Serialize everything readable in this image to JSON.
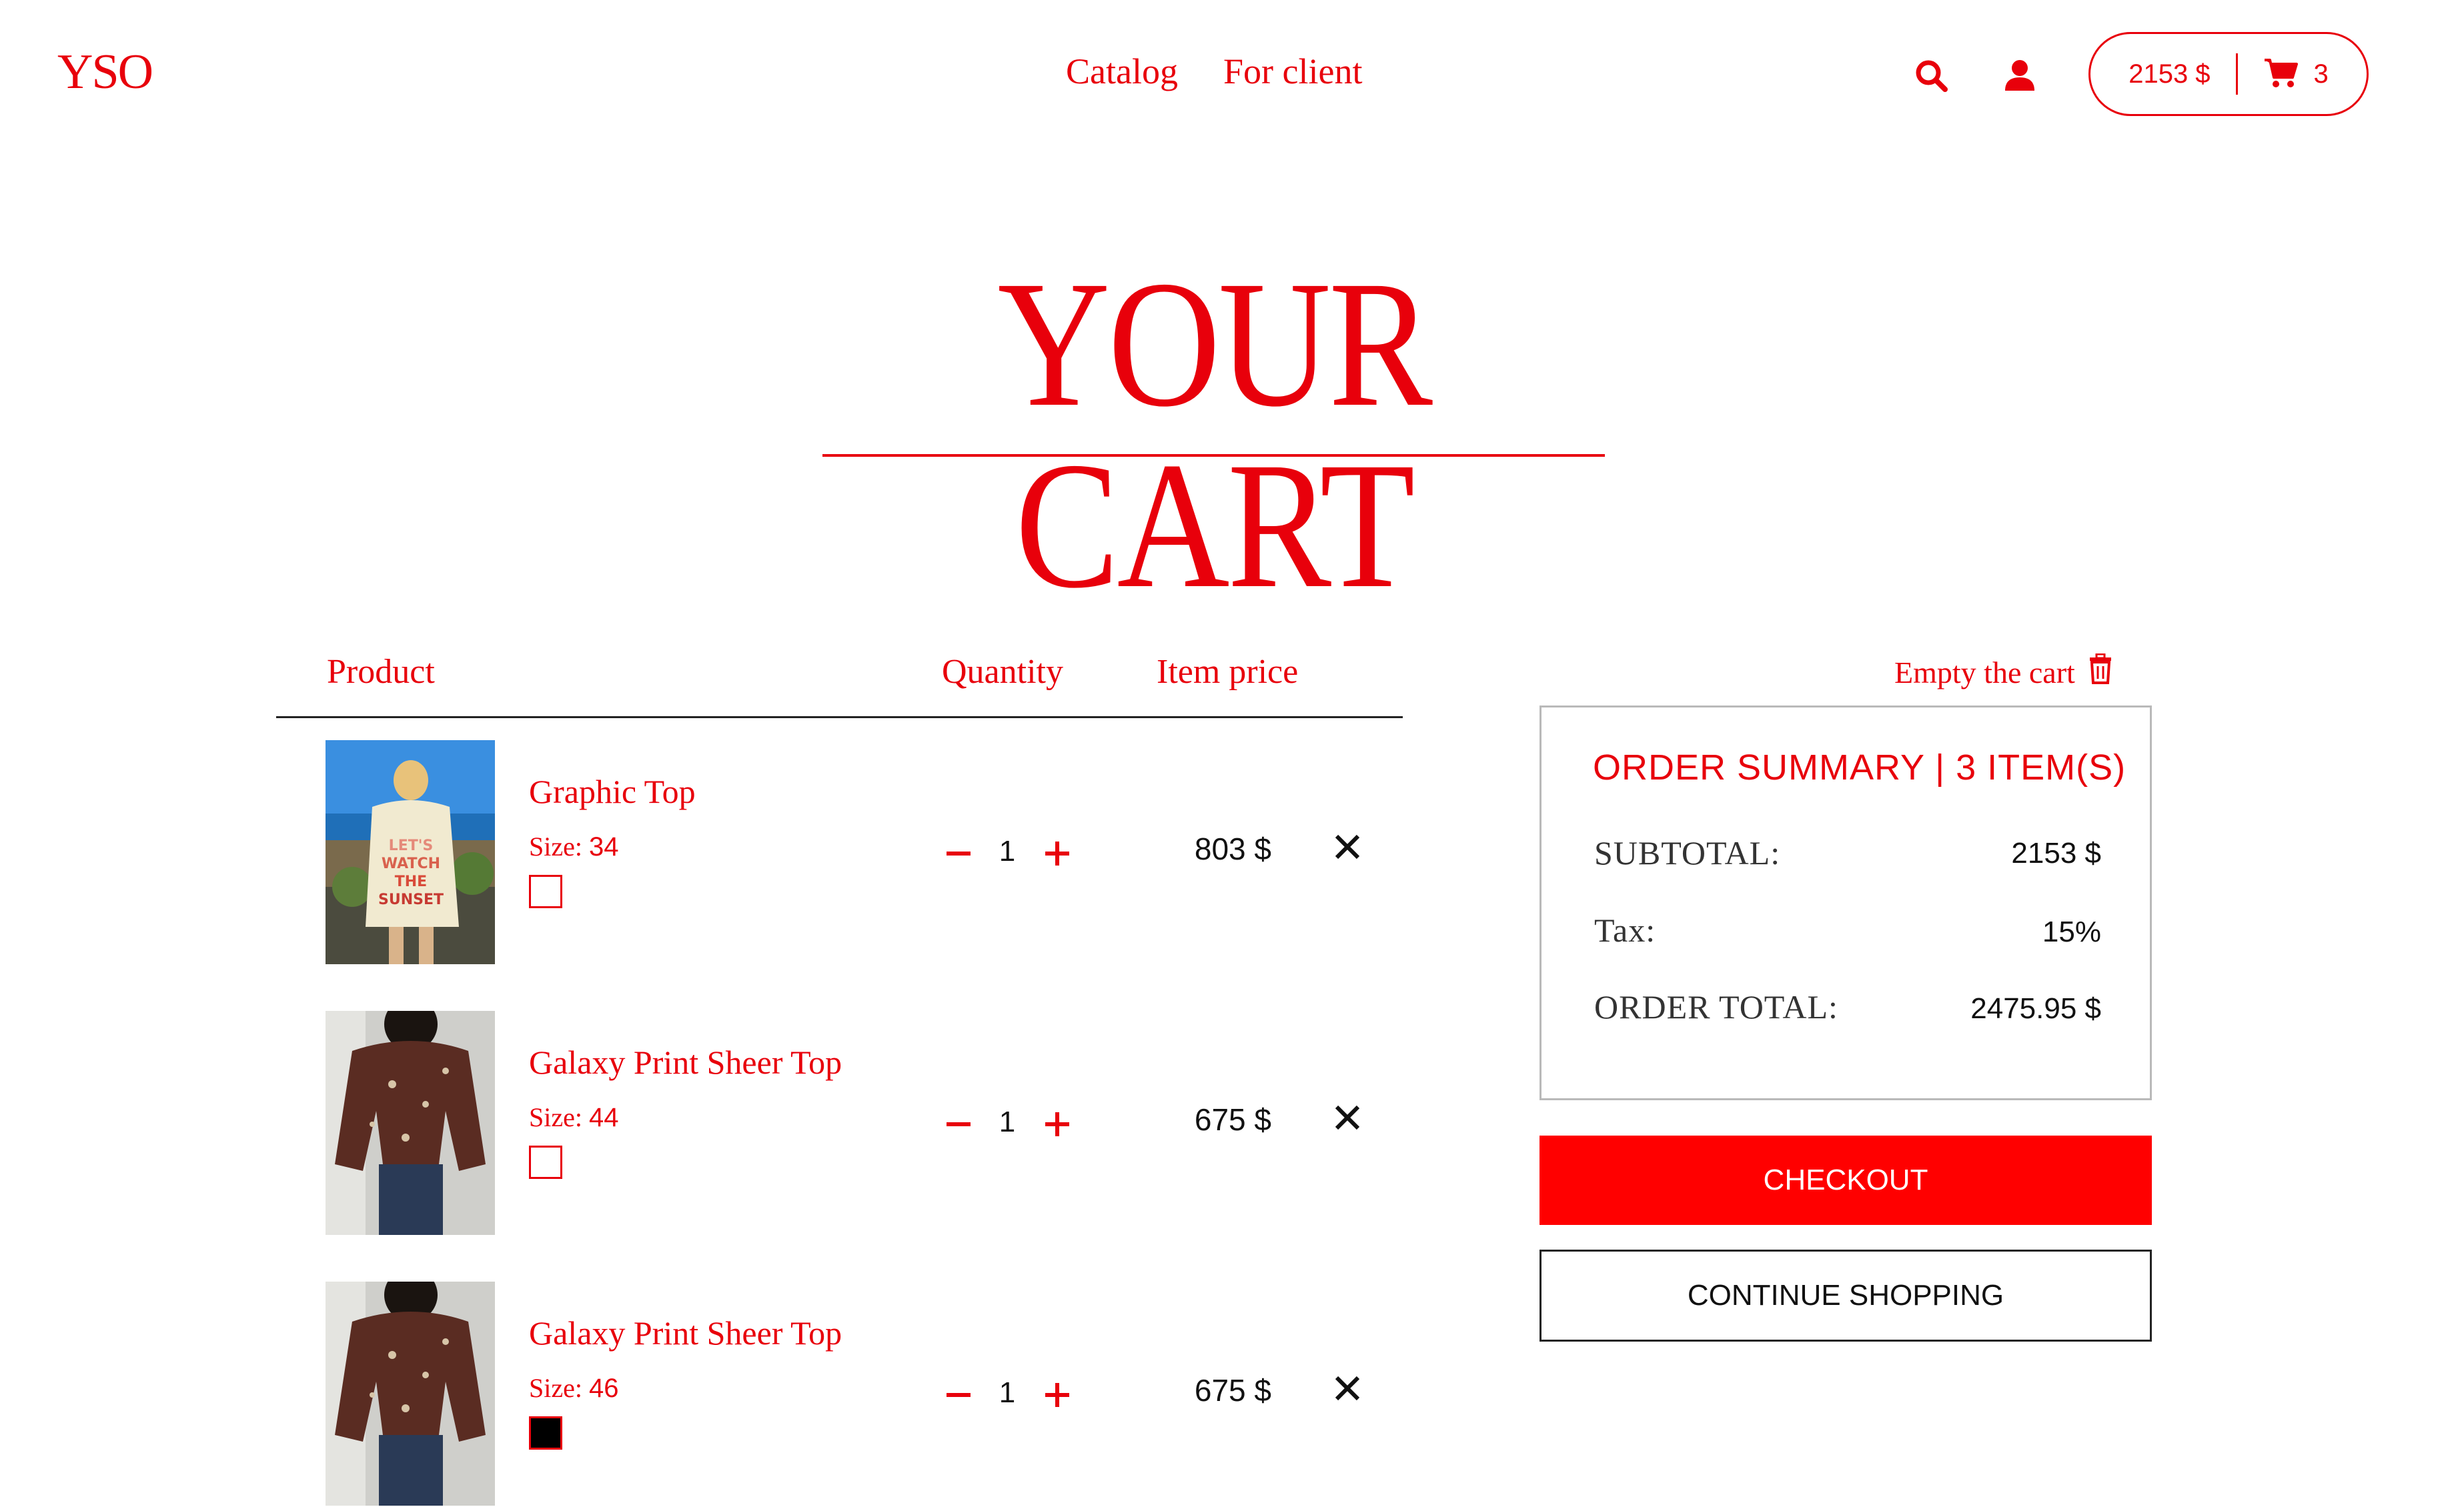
{
  "header": {
    "logo": "YSO",
    "nav": [
      "Catalog",
      "For client"
    ],
    "cart_total": "2153 $",
    "cart_count": "3"
  },
  "page_title": "YOUR CART",
  "table": {
    "headers": {
      "product": "Product",
      "quantity": "Quantity",
      "item_price": "Item price"
    },
    "items": [
      {
        "name": "Graphic Top",
        "size_label": "Size:",
        "size": "34",
        "quantity": "1",
        "price": "803 $",
        "selected": false,
        "image": "graphic-tee-photo"
      },
      {
        "name": "Galaxy Print Sheer Top",
        "size_label": "Size:",
        "size": "44",
        "quantity": "1",
        "price": "675 $",
        "selected": false,
        "image": "sheer-top-photo"
      },
      {
        "name": "Galaxy Print Sheer Top",
        "size_label": "Size:",
        "size": "46",
        "quantity": "1",
        "price": "675 $",
        "selected": true,
        "image": "sheer-top-photo"
      }
    ]
  },
  "summary": {
    "empty_cart": "Empty the cart",
    "title": "ORDER SUMMARY | 3 ITEM(S)",
    "subtotal_label": "SUBTOTAL:",
    "subtotal": "2153 $",
    "tax_label": "Tax:",
    "tax": "15%",
    "order_total_label": "ORDER TOTAL:",
    "order_total": "2475.95 $",
    "checkout": "CHECKOUT",
    "continue_shopping": "CONTINUE SHOPPING"
  },
  "colors": {
    "accent": "#e8000b",
    "checkout_bg": "#ff0000",
    "text_dark": "#111111"
  },
  "icons": [
    "search-icon",
    "user-icon",
    "cart-icon",
    "trash-icon",
    "minus-icon",
    "plus-icon",
    "close-icon"
  ]
}
